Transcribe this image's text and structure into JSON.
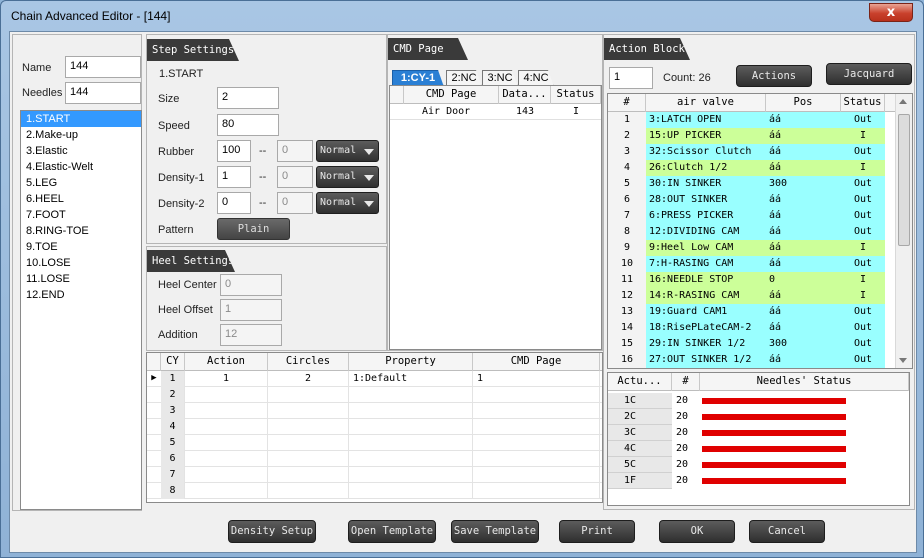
{
  "window": {
    "title": "Chain Advanced Editor - [144]",
    "close_glyph": "x"
  },
  "left": {
    "name_label": "Name",
    "name_value": "144",
    "needles_label": "Needles",
    "needles_value": "144",
    "steps": [
      "1.START",
      "2.Make-up",
      "3.Elastic",
      "4.Elastic-Welt",
      "5.LEG",
      "6.HEEL",
      "7.FOOT",
      "8.RING-TOE",
      "9.TOE",
      "10.LOSE",
      "11.LOSE",
      "12.END"
    ],
    "selected_step": 0
  },
  "step_settings": {
    "header": "Step Settings",
    "current": "1.START",
    "size_label": "Size",
    "size_value": "2",
    "speed_label": "Speed",
    "speed_value": "80",
    "rubber_label": "Rubber",
    "rubber_value": "100",
    "rubber_sep": "--",
    "rubber_to": "0",
    "rubber_mode": "Normal",
    "density1_label": "Density-1",
    "density1_value": "1",
    "density1_sep": "--",
    "density1_to": "0",
    "density1_mode": "Normal",
    "density2_label": "Density-2",
    "density2_value": "0",
    "density2_sep": "--",
    "density2_to": "0",
    "density2_mode": "Normal",
    "pattern_label": "Pattern",
    "pattern_value": "Plain"
  },
  "heel_settings": {
    "header": "Heel Settings",
    "center_label": "Heel Center",
    "center_value": "0",
    "offset_label": "Heel Offset",
    "offset_value": "1",
    "addition_label": "Addition",
    "addition_value": "12"
  },
  "cmd_page": {
    "header": "CMD Page",
    "tabs": [
      "1:CY-1",
      "2:NC",
      "3:NC",
      "4:NC"
    ],
    "active_tab": 0,
    "columns": [
      "CMD Page",
      "Data...",
      "Status"
    ],
    "rows": [
      [
        "Air Door",
        "143",
        "I"
      ]
    ]
  },
  "cy_table": {
    "columns": [
      "CY",
      "Action",
      "Circles",
      "Property",
      "CMD Page"
    ],
    "rows": [
      [
        "1",
        "1",
        "2",
        "1:Default",
        "1"
      ],
      [
        "2",
        "",
        "",
        "",
        ""
      ],
      [
        "3",
        "",
        "",
        "",
        ""
      ],
      [
        "4",
        "",
        "",
        "",
        ""
      ],
      [
        "5",
        "",
        "",
        "",
        ""
      ],
      [
        "6",
        "",
        "",
        "",
        ""
      ],
      [
        "7",
        "",
        "",
        "",
        ""
      ],
      [
        "8",
        "",
        "",
        "",
        ""
      ]
    ],
    "current_row": 0
  },
  "action_block": {
    "header": "Action Block",
    "value": "1",
    "count_label": "Count: 26",
    "actions_button": "Actions",
    "jacquard_button": "Jacquard",
    "columns": [
      "#",
      "air valve",
      "Pos",
      "Status"
    ],
    "rows": [
      [
        "1",
        "3:LATCH OPEN",
        "áá",
        "Out"
      ],
      [
        "2",
        "15:UP PICKER",
        "áá",
        "I"
      ],
      [
        "3",
        "32:Scissor Clutch",
        "áá",
        "Out"
      ],
      [
        "4",
        "26:Clutch  1/2",
        "áá",
        "I"
      ],
      [
        "5",
        "30:IN SINKER",
        "300",
        "Out"
      ],
      [
        "6",
        "28:OUT SINKER",
        "áá",
        "Out"
      ],
      [
        "7",
        "6:PRESS PICKER",
        "áá",
        "Out"
      ],
      [
        "8",
        "12:DIVIDING CAM",
        "áá",
        "Out"
      ],
      [
        "9",
        "9:Heel Low CAM",
        "áá",
        "I"
      ],
      [
        "10",
        "7:H-RASING CAM",
        "áá",
        "Out"
      ],
      [
        "11",
        "16:NEEDLE STOP",
        "0",
        "I"
      ],
      [
        "12",
        "14:R-RASING CAM",
        "áá",
        "I"
      ],
      [
        "13",
        "19:Guard CAM1",
        "áá",
        "Out"
      ],
      [
        "14",
        "18:RisePLateCAM-2",
        "áá",
        "Out"
      ],
      [
        "15",
        "29:IN SINKER 1/2",
        "300",
        "Out"
      ],
      [
        "16",
        "27:OUT SINKER 1/2",
        "áá",
        "Out"
      ]
    ],
    "colors": {
      "out": "#99ffff",
      "in": "#ccff99"
    }
  },
  "needles_status": {
    "columns": [
      "Actu...",
      "#",
      "Needles' Status"
    ],
    "rows": [
      {
        "act": "1C",
        "num": "20",
        "fill": 1.0
      },
      {
        "act": "2C",
        "num": "20",
        "fill": 1.0
      },
      {
        "act": "3C",
        "num": "20",
        "fill": 1.0
      },
      {
        "act": "4C",
        "num": "20",
        "fill": 1.0
      },
      {
        "act": "5C",
        "num": "20",
        "fill": 1.0
      },
      {
        "act": "1F",
        "num": "20",
        "fill": 1.0
      }
    ],
    "bar_color": "#e00000"
  },
  "footer": {
    "density_setup": "Density Setup",
    "open_template": "Open Template",
    "save_template": "Save Template",
    "print": "Print",
    "ok": "OK",
    "cancel": "Cancel"
  }
}
